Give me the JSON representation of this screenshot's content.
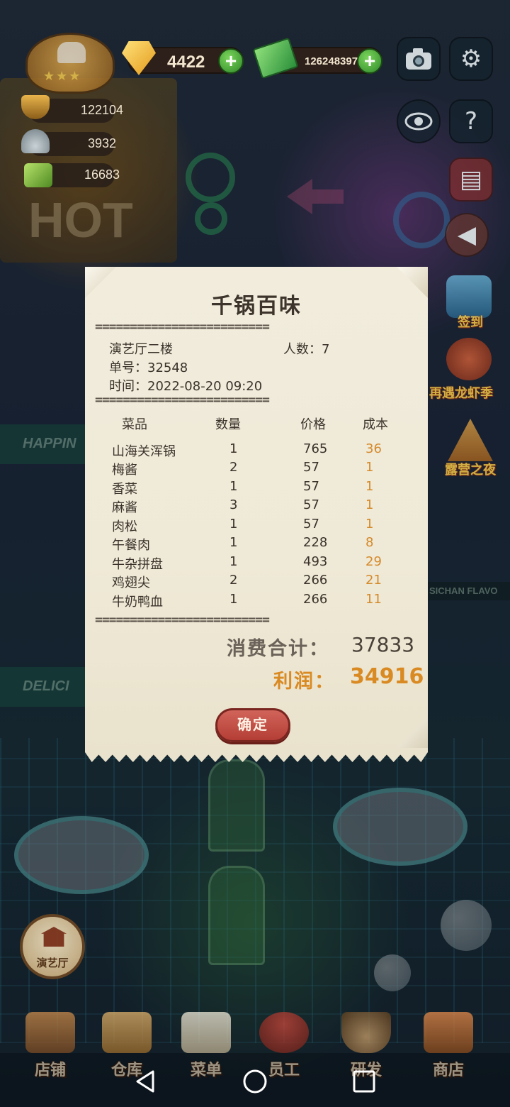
{
  "hud": {
    "gems": "4422",
    "cash": "126248397",
    "stat_hotpot": "122104",
    "stat_dishes": "3932",
    "stat_recipes": "16683"
  },
  "events": {
    "sign_in": "签到",
    "lobster": "再遇龙虾季",
    "camping": "露营之夜"
  },
  "scene_signs": {
    "happiness": "HAPPIN",
    "delicious": "DELICI",
    "sichuan": "SICHAN FLAVO",
    "hot": "HOT"
  },
  "room_button": {
    "label": "演艺厅"
  },
  "receipt": {
    "title": "千锅百味",
    "divider": "=========================",
    "hall": "演艺厅二楼",
    "people": "人数：7",
    "order_no": "单号：32548",
    "time": "时间：2022-08-20 09:20",
    "headers": {
      "dish": "菜品",
      "qty": "数量",
      "price": "价格",
      "cost": "成本"
    },
    "items": [
      {
        "name": "山海关浑锅",
        "qty": "1",
        "price": "765",
        "cost": "36"
      },
      {
        "name": "梅酱",
        "qty": "2",
        "price": "57",
        "cost": "1"
      },
      {
        "name": "香菜",
        "qty": "1",
        "price": "57",
        "cost": "1"
      },
      {
        "name": "麻酱",
        "qty": "3",
        "price": "57",
        "cost": "1"
      },
      {
        "name": "肉松",
        "qty": "1",
        "price": "57",
        "cost": "1"
      },
      {
        "name": "午餐肉",
        "qty": "1",
        "price": "228",
        "cost": "8"
      },
      {
        "name": "牛杂拼盘",
        "qty": "1",
        "price": "493",
        "cost": "29"
      },
      {
        "name": "鸡翅尖",
        "qty": "2",
        "price": "266",
        "cost": "21"
      },
      {
        "name": "牛奶鸭血",
        "qty": "1",
        "price": "266",
        "cost": "11"
      }
    ],
    "total_label": "消费合计：",
    "total_value": "37833",
    "profit_label": "利润：",
    "profit_value": "34916",
    "confirm": "确定"
  },
  "bottom_nav": [
    {
      "label": "店铺",
      "icon": "storefront-icon"
    },
    {
      "label": "仓库",
      "icon": "boxes-icon"
    },
    {
      "label": "菜单",
      "icon": "clipboard-icon"
    },
    {
      "label": "员工",
      "icon": "staff-icon"
    },
    {
      "label": "研发",
      "icon": "pot-icon"
    },
    {
      "label": "商店",
      "icon": "shop-icon"
    }
  ],
  "colors": {
    "receipt_paper": "#efe9d7",
    "cost_orange": "#d48a2a",
    "profit_orange": "#d98a22",
    "confirm_red": "#c24c43"
  }
}
